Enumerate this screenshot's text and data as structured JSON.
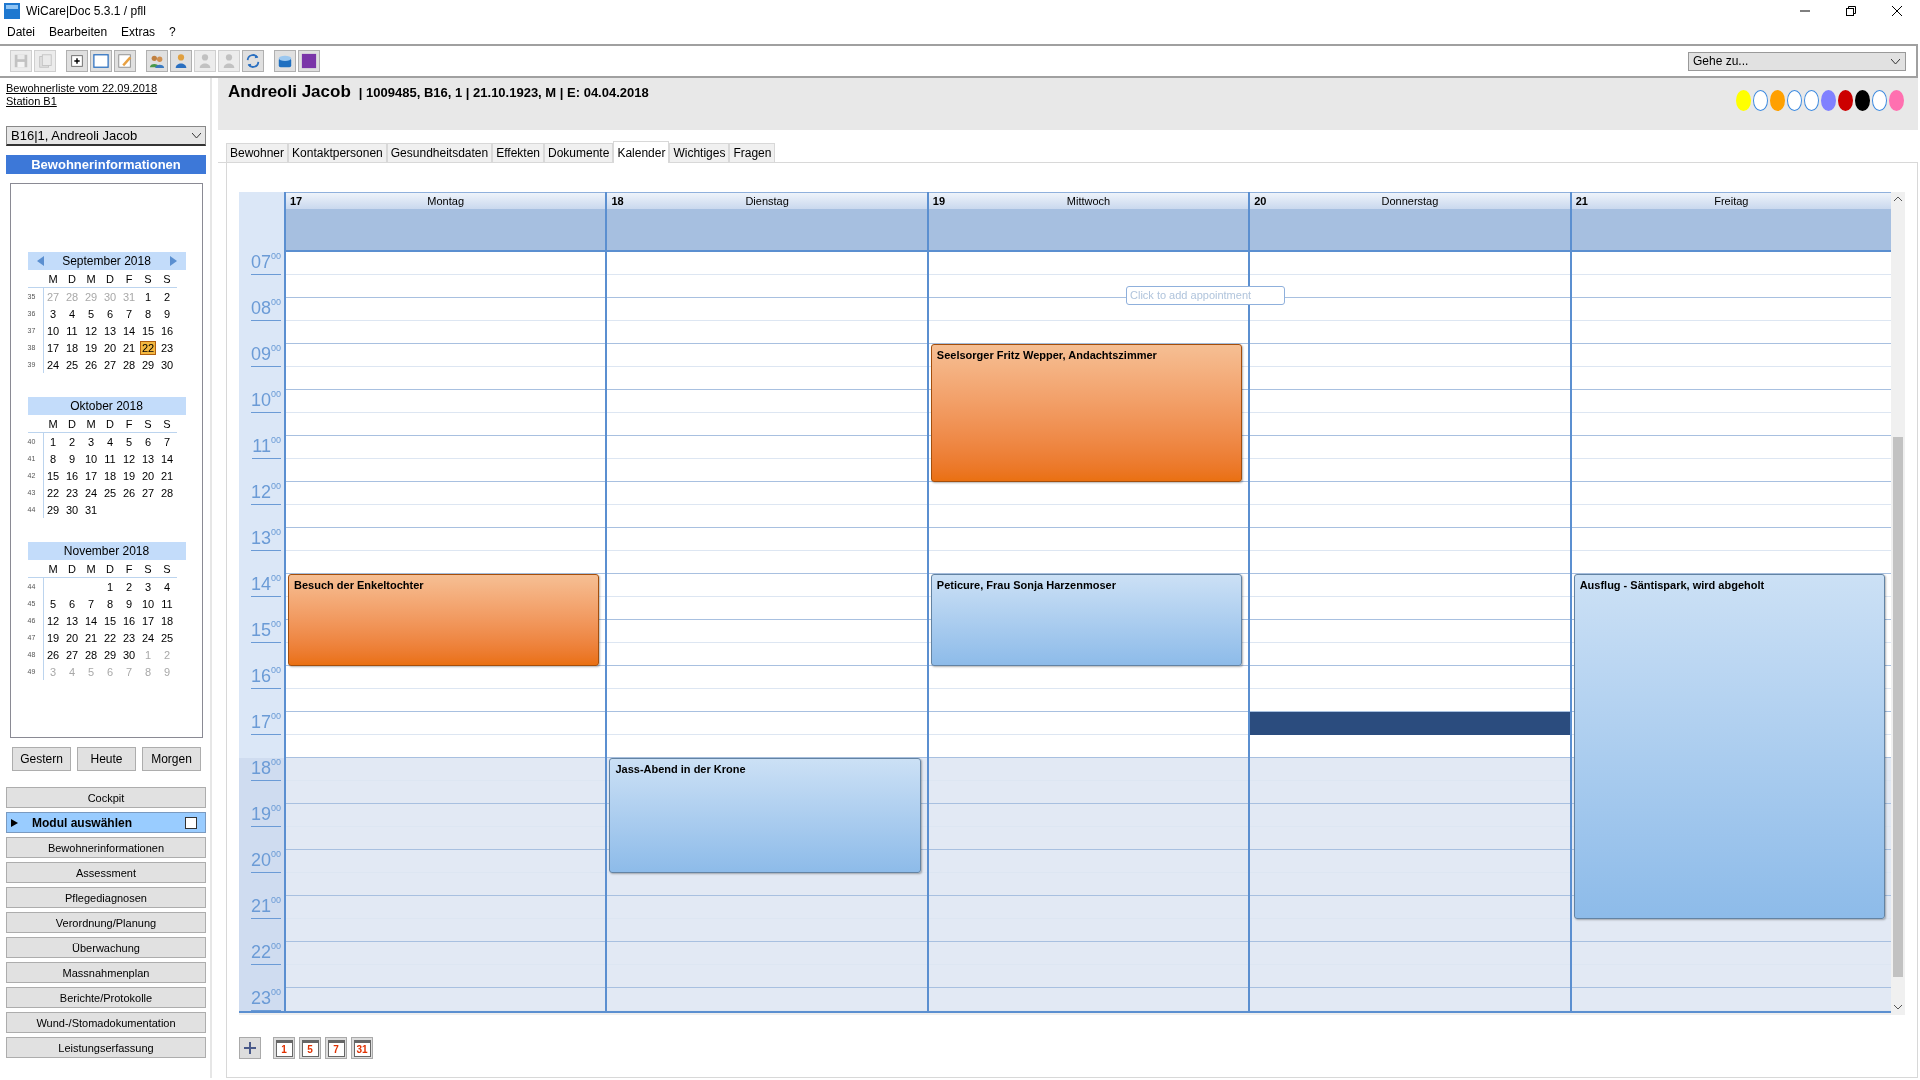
{
  "window": {
    "title": "WiCare|Doc 5.3.1  / pfll"
  },
  "menu": [
    "Datei",
    "Bearbeiten",
    "Extras",
    "?"
  ],
  "toolbar": {
    "groups": [
      [
        {
          "kind": "save",
          "disabled": true
        },
        {
          "kind": "pages",
          "disabled": true
        }
      ],
      [
        {
          "kind": "add",
          "disabled": false
        },
        {
          "kind": "window",
          "disabled": false
        },
        {
          "kind": "edit",
          "disabled": false
        }
      ],
      [
        {
          "kind": "people",
          "disabled": false
        },
        {
          "kind": "person",
          "disabled": false
        },
        {
          "kind": "person",
          "disabled": true
        },
        {
          "kind": "person",
          "disabled": true
        },
        {
          "kind": "refresh",
          "disabled": false
        }
      ],
      [
        {
          "kind": "box",
          "disabled": false
        },
        {
          "kind": "square",
          "disabled": false
        }
      ]
    ],
    "goto": {
      "placeholder": "Gehe zu..."
    }
  },
  "sidebar": {
    "links": [
      "Bewohnerliste vom 22.09.2018",
      "Station B1"
    ],
    "resident_select": "B16|1, Andreoli Jacob",
    "section_title": "Bewohnerinformationen",
    "months": [
      {
        "title": "September 2018",
        "arrows": true,
        "weekdays": [
          "M",
          "D",
          "M",
          "D",
          "F",
          "S",
          "S"
        ],
        "weeks": [
          {
            "number": "35",
            "days": [
              {
                "d": "27",
                "muted": true,
                "selected": false
              },
              {
                "d": "28",
                "muted": true,
                "selected": false
              },
              {
                "d": "29",
                "muted": true,
                "selected": false
              },
              {
                "d": "30",
                "muted": true,
                "selected": false
              },
              {
                "d": "31",
                "muted": true,
                "selected": false
              },
              {
                "d": "1",
                "muted": false,
                "selected": false
              },
              {
                "d": "2",
                "muted": false,
                "selected": false
              }
            ]
          },
          {
            "number": "36",
            "days": [
              {
                "d": "3",
                "muted": false,
                "selected": false
              },
              {
                "d": "4",
                "muted": false,
                "selected": false
              },
              {
                "d": "5",
                "muted": false,
                "selected": false
              },
              {
                "d": "6",
                "muted": false,
                "selected": false
              },
              {
                "d": "7",
                "muted": false,
                "selected": false
              },
              {
                "d": "8",
                "muted": false,
                "selected": false
              },
              {
                "d": "9",
                "muted": false,
                "selected": false
              }
            ]
          },
          {
            "number": "37",
            "days": [
              {
                "d": "10",
                "muted": false,
                "selected": false
              },
              {
                "d": "11",
                "muted": false,
                "selected": false
              },
              {
                "d": "12",
                "muted": false,
                "selected": false
              },
              {
                "d": "13",
                "muted": false,
                "selected": false
              },
              {
                "d": "14",
                "muted": false,
                "selected": false
              },
              {
                "d": "15",
                "muted": false,
                "selected": false
              },
              {
                "d": "16",
                "muted": false,
                "selected": false
              }
            ]
          },
          {
            "number": "38",
            "days": [
              {
                "d": "17",
                "muted": false,
                "selected": false
              },
              {
                "d": "18",
                "muted": false,
                "selected": false
              },
              {
                "d": "19",
                "muted": false,
                "selected": false
              },
              {
                "d": "20",
                "muted": false,
                "selected": false
              },
              {
                "d": "21",
                "muted": false,
                "selected": false
              },
              {
                "d": "22",
                "muted": false,
                "selected": true
              },
              {
                "d": "23",
                "muted": false,
                "selected": false
              }
            ]
          },
          {
            "number": "39",
            "days": [
              {
                "d": "24",
                "muted": false,
                "selected": false
              },
              {
                "d": "25",
                "muted": false,
                "selected": false
              },
              {
                "d": "26",
                "muted": false,
                "selected": false
              },
              {
                "d": "27",
                "muted": false,
                "selected": false
              },
              {
                "d": "28",
                "muted": false,
                "selected": false
              },
              {
                "d": "29",
                "muted": false,
                "selected": false
              },
              {
                "d": "30",
                "muted": false,
                "selected": false
              }
            ]
          }
        ]
      },
      {
        "title": "Oktober 2018",
        "arrows": false,
        "weekdays": [
          "M",
          "D",
          "M",
          "D",
          "F",
          "S",
          "S"
        ],
        "weeks": [
          {
            "number": "40",
            "days": [
              {
                "d": "1",
                "muted": false,
                "selected": false
              },
              {
                "d": "2",
                "muted": false,
                "selected": false
              },
              {
                "d": "3",
                "muted": false,
                "selected": false
              },
              {
                "d": "4",
                "muted": false,
                "selected": false
              },
              {
                "d": "5",
                "muted": false,
                "selected": false
              },
              {
                "d": "6",
                "muted": false,
                "selected": false
              },
              {
                "d": "7",
                "muted": false,
                "selected": false
              }
            ]
          },
          {
            "number": "41",
            "days": [
              {
                "d": "8",
                "muted": false,
                "selected": false
              },
              {
                "d": "9",
                "muted": false,
                "selected": false
              },
              {
                "d": "10",
                "muted": false,
                "selected": false
              },
              {
                "d": "11",
                "muted": false,
                "selected": false
              },
              {
                "d": "12",
                "muted": false,
                "selected": false
              },
              {
                "d": "13",
                "muted": false,
                "selected": false
              },
              {
                "d": "14",
                "muted": false,
                "selected": false
              }
            ]
          },
          {
            "number": "42",
            "days": [
              {
                "d": "15",
                "muted": false,
                "selected": false
              },
              {
                "d": "16",
                "muted": false,
                "selected": false
              },
              {
                "d": "17",
                "muted": false,
                "selected": false
              },
              {
                "d": "18",
                "muted": false,
                "selected": false
              },
              {
                "d": "19",
                "muted": false,
                "selected": false
              },
              {
                "d": "20",
                "muted": false,
                "selected": false
              },
              {
                "d": "21",
                "muted": false,
                "selected": false
              }
            ]
          },
          {
            "number": "43",
            "days": [
              {
                "d": "22",
                "muted": false,
                "selected": false
              },
              {
                "d": "23",
                "muted": false,
                "selected": false
              },
              {
                "d": "24",
                "muted": false,
                "selected": false
              },
              {
                "d": "25",
                "muted": false,
                "selected": false
              },
              {
                "d": "26",
                "muted": false,
                "selected": false
              },
              {
                "d": "27",
                "muted": false,
                "selected": false
              },
              {
                "d": "28",
                "muted": false,
                "selected": false
              }
            ]
          },
          {
            "number": "44",
            "days": [
              {
                "d": "29",
                "muted": false,
                "selected": false
              },
              {
                "d": "30",
                "muted": false,
                "selected": false
              },
              {
                "d": "31",
                "muted": false,
                "selected": false
              }
            ]
          }
        ]
      },
      {
        "title": "November 2018",
        "arrows": false,
        "weekdays": [
          "M",
          "D",
          "M",
          "D",
          "F",
          "S",
          "S"
        ],
        "weeks": [
          {
            "number": "44",
            "days": [
              {
                "d": "1",
                "muted": false,
                "selected": false
              },
              {
                "d": "2",
                "muted": false,
                "selected": false
              },
              {
                "d": "3",
                "muted": false,
                "selected": false
              },
              {
                "d": "4",
                "muted": false,
                "selected": false
              }
            ]
          },
          {
            "number": "45",
            "days": [
              {
                "d": "5",
                "muted": false,
                "selected": false
              },
              {
                "d": "6",
                "muted": false,
                "selected": false
              },
              {
                "d": "7",
                "muted": false,
                "selected": false
              },
              {
                "d": "8",
                "muted": false,
                "selected": false
              },
              {
                "d": "9",
                "muted": false,
                "selected": false
              },
              {
                "d": "10",
                "muted": false,
                "selected": false
              },
              {
                "d": "11",
                "muted": false,
                "selected": false
              }
            ]
          },
          {
            "number": "46",
            "days": [
              {
                "d": "12",
                "muted": false,
                "selected": false
              },
              {
                "d": "13",
                "muted": false,
                "selected": false
              },
              {
                "d": "14",
                "muted": false,
                "selected": false
              },
              {
                "d": "15",
                "muted": false,
                "selected": false
              },
              {
                "d": "16",
                "muted": false,
                "selected": false
              },
              {
                "d": "17",
                "muted": false,
                "selected": false
              },
              {
                "d": "18",
                "muted": false,
                "selected": false
              }
            ]
          },
          {
            "number": "47",
            "days": [
              {
                "d": "19",
                "muted": false,
                "selected": false
              },
              {
                "d": "20",
                "muted": false,
                "selected": false
              },
              {
                "d": "21",
                "muted": false,
                "selected": false
              },
              {
                "d": "22",
                "muted": false,
                "selected": false
              },
              {
                "d": "23",
                "muted": false,
                "selected": false
              },
              {
                "d": "24",
                "muted": false,
                "selected": false
              },
              {
                "d": "25",
                "muted": false,
                "selected": false
              }
            ]
          },
          {
            "number": "48",
            "days": [
              {
                "d": "26",
                "muted": false,
                "selected": false
              },
              {
                "d": "27",
                "muted": false,
                "selected": false
              },
              {
                "d": "28",
                "muted": false,
                "selected": false
              },
              {
                "d": "29",
                "muted": false,
                "selected": false
              },
              {
                "d": "30",
                "muted": false,
                "selected": false
              },
              {
                "d": "1",
                "muted": true,
                "selected": false
              },
              {
                "d": "2",
                "muted": true,
                "selected": false
              }
            ]
          },
          {
            "number": "49",
            "days": [
              {
                "d": "3",
                "muted": true,
                "selected": false
              },
              {
                "d": "4",
                "muted": true,
                "selected": false
              },
              {
                "d": "5",
                "muted": true,
                "selected": false
              },
              {
                "d": "6",
                "muted": true,
                "selected": false
              },
              {
                "d": "7",
                "muted": true,
                "selected": false
              },
              {
                "d": "8",
                "muted": true,
                "selected": false
              },
              {
                "d": "9",
                "muted": true,
                "selected": false
              }
            ]
          }
        ]
      }
    ],
    "nav_buttons": [
      "Gestern",
      "Heute",
      "Morgen"
    ],
    "modules": [
      {
        "kind": "button",
        "label": "Cockpit"
      },
      {
        "kind": "group",
        "label": "Modul auswählen",
        "checked": false
      },
      {
        "kind": "button",
        "label": "Bewohnerinformationen"
      },
      {
        "kind": "button",
        "label": "Assessment"
      },
      {
        "kind": "button",
        "label": "Pflegediagnosen"
      },
      {
        "kind": "button",
        "label": "Verordnung/Planung"
      },
      {
        "kind": "button",
        "label": "Überwachung"
      },
      {
        "kind": "button",
        "label": "Massnahmenplan"
      },
      {
        "kind": "button",
        "label": "Berichte/Protokolle"
      },
      {
        "kind": "button",
        "label": "Wund-/Stomadokumentation"
      },
      {
        "kind": "button",
        "label": "Leistungserfassung"
      }
    ]
  },
  "patient": {
    "name": "Andreoli Jacob",
    "details": "| 1009485, B16, 1 | 21.10.1923, M | E: 04.04.2018",
    "dots": [
      {
        "color": "#ffff00"
      },
      {
        "color": "#ffffff"
      },
      {
        "color": "#ffa000"
      },
      {
        "color": "#ffffff"
      },
      {
        "color": "#ffffff"
      },
      {
        "color": "#8080ff"
      },
      {
        "color": "#cc0000"
      },
      {
        "color": "#000000"
      },
      {
        "color": "#ffffff"
      },
      {
        "color": "#ff70b0"
      }
    ]
  },
  "tabs": [
    {
      "label": "Bewohner",
      "selected": false
    },
    {
      "label": "Kontaktpersonen",
      "selected": false
    },
    {
      "label": "Gesundheitsdaten",
      "selected": false
    },
    {
      "label": "Effekten",
      "selected": false
    },
    {
      "label": "Dokumente",
      "selected": false
    },
    {
      "label": "Kalender",
      "selected": true
    },
    {
      "label": "Wichtiges",
      "selected": false
    },
    {
      "label": "Fragen",
      "selected": false
    }
  ],
  "calendar": {
    "hint": "Click to add appointment",
    "hours": [
      {
        "h": "07",
        "m": "00",
        "off": false
      },
      {
        "h": "08",
        "m": "00",
        "off": false
      },
      {
        "h": "09",
        "m": "00",
        "off": false
      },
      {
        "h": "10",
        "m": "00",
        "off": false
      },
      {
        "h": "11",
        "m": "00",
        "off": false
      },
      {
        "h": "12",
        "m": "00",
        "off": false
      },
      {
        "h": "13",
        "m": "00",
        "off": false
      },
      {
        "h": "14",
        "m": "00",
        "off": false
      },
      {
        "h": "15",
        "m": "00",
        "off": false
      },
      {
        "h": "16",
        "m": "00",
        "off": false
      },
      {
        "h": "17",
        "m": "00",
        "off": false
      },
      {
        "h": "18",
        "m": "00",
        "off": true
      },
      {
        "h": "19",
        "m": "00",
        "off": true
      },
      {
        "h": "20",
        "m": "00",
        "off": true
      },
      {
        "h": "21",
        "m": "00",
        "off": true
      },
      {
        "h": "22",
        "m": "00",
        "off": true
      },
      {
        "h": "23",
        "m": "00",
        "off": true
      }
    ],
    "days": [
      {
        "num": "17",
        "name": "Montag",
        "slots": [
          {
            "kind": "free"
          },
          {
            "kind": "free"
          },
          {
            "kind": "free"
          },
          {
            "kind": "free"
          },
          {
            "kind": "free"
          },
          {
            "kind": "free"
          },
          {
            "kind": "free"
          },
          {
            "kind": "free"
          },
          {
            "kind": "free"
          },
          {
            "kind": "free"
          },
          {
            "kind": "free"
          },
          {
            "kind": "free"
          },
          {
            "kind": "free"
          },
          {
            "kind": "free"
          },
          {
            "kind": "event",
            "title": "Besuch der Enkeltochter",
            "color": "#ea7010"
          },
          {
            "kind": "cont"
          },
          {
            "kind": "cont"
          },
          {
            "kind": "cont"
          },
          {
            "kind": "free"
          },
          {
            "kind": "free"
          },
          {
            "kind": "free"
          },
          {
            "kind": "free"
          },
          {
            "kind": "free"
          },
          {
            "kind": "free"
          },
          {
            "kind": "free"
          },
          {
            "kind": "free"
          },
          {
            "kind": "free"
          },
          {
            "kind": "free"
          },
          {
            "kind": "free"
          },
          {
            "kind": "free"
          },
          {
            "kind": "free"
          },
          {
            "kind": "free"
          },
          {
            "kind": "free"
          },
          {
            "kind": "free"
          }
        ]
      },
      {
        "num": "18",
        "name": "Dienstag",
        "slots": [
          {
            "kind": "free"
          },
          {
            "kind": "free"
          },
          {
            "kind": "free"
          },
          {
            "kind": "free"
          },
          {
            "kind": "free"
          },
          {
            "kind": "free"
          },
          {
            "kind": "free"
          },
          {
            "kind": "free"
          },
          {
            "kind": "free"
          },
          {
            "kind": "free"
          },
          {
            "kind": "free"
          },
          {
            "kind": "free"
          },
          {
            "kind": "free"
          },
          {
            "kind": "free"
          },
          {
            "kind": "free"
          },
          {
            "kind": "free"
          },
          {
            "kind": "free"
          },
          {
            "kind": "free"
          },
          {
            "kind": "free"
          },
          {
            "kind": "free"
          },
          {
            "kind": "free"
          },
          {
            "kind": "free"
          },
          {
            "kind": "event",
            "title": "Jass-Abend in der Krone",
            "color": "#8dbbe9"
          },
          {
            "kind": "cont"
          },
          {
            "kind": "cont"
          },
          {
            "kind": "cont"
          },
          {
            "kind": "cont"
          },
          {
            "kind": "free"
          },
          {
            "kind": "free"
          },
          {
            "kind": "free"
          },
          {
            "kind": "free"
          },
          {
            "kind": "free"
          },
          {
            "kind": "free"
          },
          {
            "kind": "free"
          }
        ]
      },
      {
        "num": "19",
        "name": "Mittwoch",
        "slots": [
          {
            "kind": "free"
          },
          {
            "kind": "free"
          },
          {
            "kind": "free"
          },
          {
            "kind": "free"
          },
          {
            "kind": "event",
            "title": "Seelsorger Fritz Wepper, Andachtszimmer",
            "color": "#ea7010"
          },
          {
            "kind": "cont"
          },
          {
            "kind": "cont"
          },
          {
            "kind": "cont"
          },
          {
            "kind": "cont"
          },
          {
            "kind": "cont"
          },
          {
            "kind": "free"
          },
          {
            "kind": "free"
          },
          {
            "kind": "free"
          },
          {
            "kind": "free"
          },
          {
            "kind": "event",
            "title": "Peticure, Frau Sonja Harzenmoser",
            "color": "#8dbbe9"
          },
          {
            "kind": "cont"
          },
          {
            "kind": "cont"
          },
          {
            "kind": "cont"
          },
          {
            "kind": "free"
          },
          {
            "kind": "free"
          },
          {
            "kind": "free"
          },
          {
            "kind": "free"
          },
          {
            "kind": "free"
          },
          {
            "kind": "free"
          },
          {
            "kind": "free"
          },
          {
            "kind": "free"
          },
          {
            "kind": "free"
          },
          {
            "kind": "free"
          },
          {
            "kind": "free"
          },
          {
            "kind": "free"
          },
          {
            "kind": "free"
          },
          {
            "kind": "free"
          },
          {
            "kind": "free"
          },
          {
            "kind": "free"
          }
        ]
      },
      {
        "num": "20",
        "name": "Donnerstag",
        "slots": [
          {
            "kind": "free"
          },
          {
            "kind": "free"
          },
          {
            "kind": "free"
          },
          {
            "kind": "free"
          },
          {
            "kind": "free"
          },
          {
            "kind": "free"
          },
          {
            "kind": "free"
          },
          {
            "kind": "free"
          },
          {
            "kind": "free"
          },
          {
            "kind": "free"
          },
          {
            "kind": "free"
          },
          {
            "kind": "free"
          },
          {
            "kind": "free"
          },
          {
            "kind": "free"
          },
          {
            "kind": "free"
          },
          {
            "kind": "free"
          },
          {
            "kind": "free"
          },
          {
            "kind": "free"
          },
          {
            "kind": "free"
          },
          {
            "kind": "free"
          },
          {
            "kind": "selected"
          },
          {
            "kind": "free"
          },
          {
            "kind": "free"
          },
          {
            "kind": "free"
          },
          {
            "kind": "free"
          },
          {
            "kind": "free"
          },
          {
            "kind": "free"
          },
          {
            "kind": "free"
          },
          {
            "kind": "free"
          },
          {
            "kind": "free"
          },
          {
            "kind": "free"
          },
          {
            "kind": "free"
          },
          {
            "kind": "free"
          },
          {
            "kind": "free"
          }
        ]
      },
      {
        "num": "21",
        "name": "Freitag",
        "slots": [
          {
            "kind": "free"
          },
          {
            "kind": "free"
          },
          {
            "kind": "free"
          },
          {
            "kind": "free"
          },
          {
            "kind": "free"
          },
          {
            "kind": "free"
          },
          {
            "kind": "free"
          },
          {
            "kind": "free"
          },
          {
            "kind": "free"
          },
          {
            "kind": "free"
          },
          {
            "kind": "free"
          },
          {
            "kind": "free"
          },
          {
            "kind": "free"
          },
          {
            "kind": "free"
          },
          {
            "kind": "event",
            "title": "Ausflug - Säntispark, wird abgeholt",
            "color": "#8dbbe9"
          },
          {
            "kind": "cont"
          },
          {
            "kind": "cont"
          },
          {
            "kind": "cont"
          },
          {
            "kind": "cont"
          },
          {
            "kind": "cont"
          },
          {
            "kind": "cont"
          },
          {
            "kind": "cont"
          },
          {
            "kind": "cont"
          },
          {
            "kind": "cont"
          },
          {
            "kind": "cont"
          },
          {
            "kind": "cont"
          },
          {
            "kind": "cont"
          },
          {
            "kind": "cont"
          },
          {
            "kind": "cont"
          },
          {
            "kind": "free"
          },
          {
            "kind": "free"
          },
          {
            "kind": "free"
          },
          {
            "kind": "free"
          }
        ]
      }
    ],
    "view_buttons": [
      {
        "kind": "add"
      },
      {
        "kind": "view",
        "label": "1"
      },
      {
        "kind": "view",
        "label": "5"
      },
      {
        "kind": "view",
        "label": "7"
      },
      {
        "kind": "view",
        "label": "31"
      }
    ]
  }
}
